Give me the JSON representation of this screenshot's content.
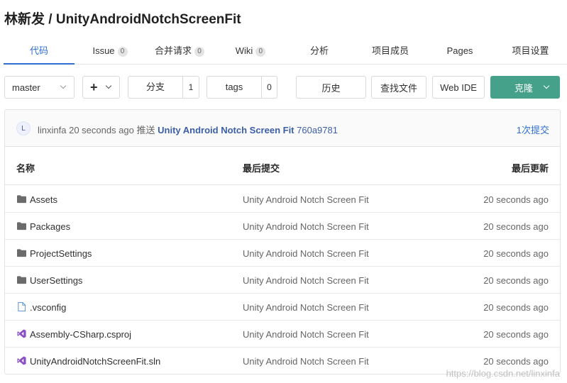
{
  "repo": {
    "owner": "林新发",
    "separator": " / ",
    "name": "UnityAndroidNotchScreenFit"
  },
  "tabs": [
    {
      "label": "代码",
      "count": null
    },
    {
      "label": "Issue",
      "count": "0"
    },
    {
      "label": "合并请求",
      "count": "0"
    },
    {
      "label": "Wiki",
      "count": "0"
    },
    {
      "label": "分析",
      "count": null
    },
    {
      "label": "项目成员",
      "count": null
    },
    {
      "label": "Pages",
      "count": null
    },
    {
      "label": "项目设置",
      "count": null
    }
  ],
  "toolbar": {
    "branch": "master",
    "add_symbol": "+",
    "branches_label": "分支",
    "branches_count": "1",
    "tags_label": "tags",
    "tags_count": "0",
    "history_label": "历史",
    "find_file_label": "查找文件",
    "web_ide_label": "Web IDE",
    "clone_label": "克隆"
  },
  "last_commit": {
    "avatar_letter": "L",
    "author": "linxinfa",
    "time": "20 seconds ago",
    "action": "推送",
    "message": "Unity Android Notch Screen Fit",
    "sha": "760a9781",
    "commit_count": "1次提交"
  },
  "table": {
    "headers": {
      "name": "名称",
      "last_commit": "最后提交",
      "last_update": "最后更新"
    },
    "rows": [
      {
        "icon": "folder-icon",
        "name": "Assets",
        "commit": "Unity Android Notch Screen Fit",
        "updated": "20 seconds ago"
      },
      {
        "icon": "folder-icon",
        "name": "Packages",
        "commit": "Unity Android Notch Screen Fit",
        "updated": "20 seconds ago"
      },
      {
        "icon": "folder-icon",
        "name": "ProjectSettings",
        "commit": "Unity Android Notch Screen Fit",
        "updated": "20 seconds ago"
      },
      {
        "icon": "folder-icon",
        "name": "UserSettings",
        "commit": "Unity Android Notch Screen Fit",
        "updated": "20 seconds ago"
      },
      {
        "icon": "file-icon",
        "name": ".vsconfig",
        "commit": "Unity Android Notch Screen Fit",
        "updated": "20 seconds ago"
      },
      {
        "icon": "visual-studio-icon",
        "name": "Assembly-CSharp.csproj",
        "commit": "Unity Android Notch Screen Fit",
        "updated": "20 seconds ago"
      },
      {
        "icon": "visual-studio-icon",
        "name": "UnityAndroidNotchScreenFit.sln",
        "commit": "Unity Android Notch Screen Fit",
        "updated": "20 seconds ago"
      }
    ]
  },
  "watermark": "https://blog.csdn.net/linxinfa",
  "colors": {
    "accent": "#2f6fd0",
    "clone": "#45a18a",
    "vs_purple": "#8a4fc6"
  }
}
